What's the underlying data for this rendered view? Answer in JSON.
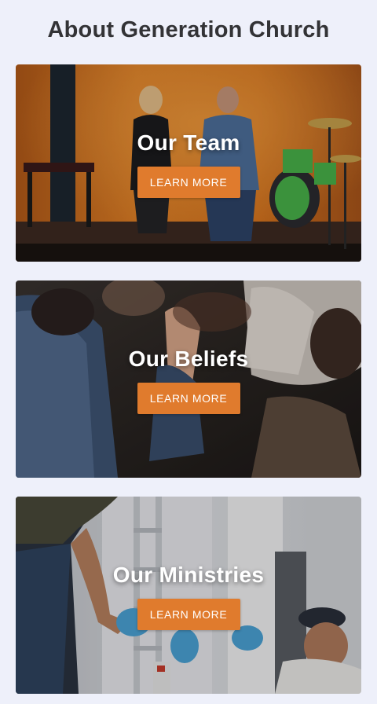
{
  "page": {
    "title": "About Generation Church"
  },
  "cards": [
    {
      "title": "Our Team",
      "button_label": "LEARN MORE"
    },
    {
      "title": "Our Beliefs",
      "button_label": "LEARN MORE"
    },
    {
      "title": "Our Ministries",
      "button_label": "LEARN MORE"
    }
  ],
  "colors": {
    "background": "#eef0fa",
    "button": "#e07b2d",
    "title_text": "#333336"
  }
}
